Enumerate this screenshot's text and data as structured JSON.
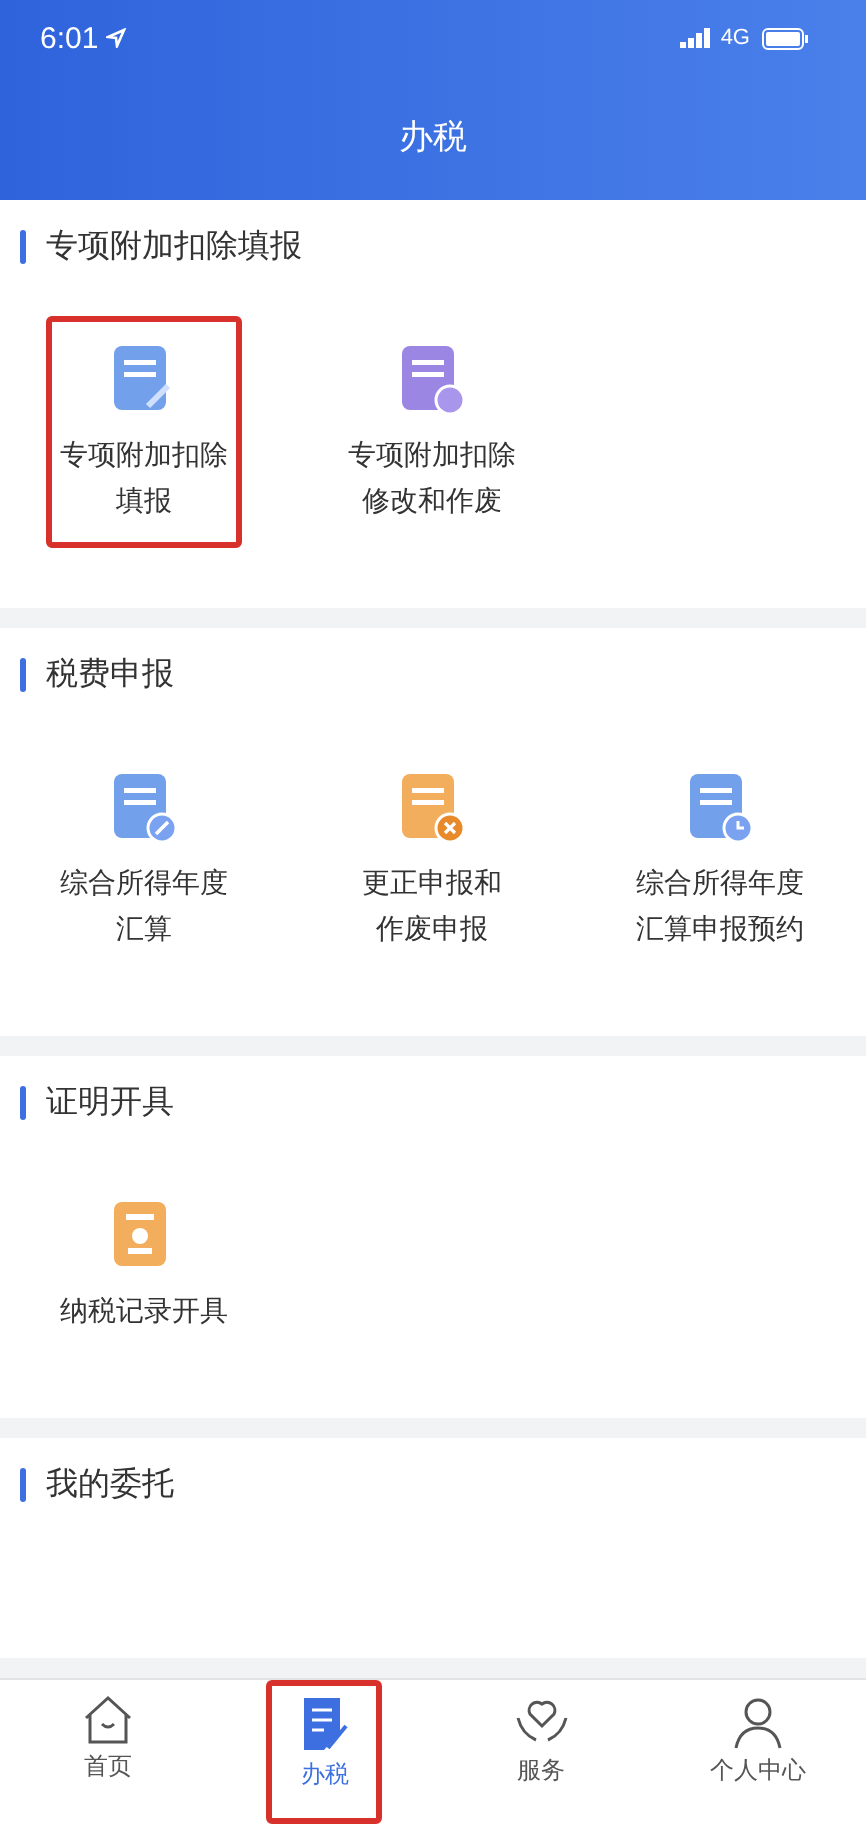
{
  "status_bar": {
    "time": "6:01",
    "network": "4G"
  },
  "header": {
    "title": "办税"
  },
  "sections": [
    {
      "title": "专项附加扣除填报",
      "items": [
        {
          "kind": "pen",
          "lines": [
            "专项附加扣除",
            "填报"
          ],
          "highlighted": true
        },
        {
          "kind": "gear",
          "lines": [
            "专项附加扣除",
            "修改和作废"
          ],
          "highlighted": false
        }
      ]
    },
    {
      "title": "税费申报",
      "items": [
        {
          "kind": "edit",
          "lines": [
            "综合所得年度",
            "汇算"
          ],
          "highlighted": false
        },
        {
          "kind": "cancel",
          "lines": [
            "更正申报和",
            "作废申报"
          ],
          "highlighted": false
        },
        {
          "kind": "clock",
          "lines": [
            "综合所得年度",
            "汇算申报预约"
          ],
          "highlighted": false
        }
      ]
    },
    {
      "title": "证明开具",
      "items": [
        {
          "kind": "certificate",
          "lines": [
            "纳税记录开具"
          ],
          "highlighted": false
        }
      ]
    },
    {
      "title": "我的委托"
    }
  ],
  "tab_bar": [
    {
      "kind": "home",
      "label": "首页",
      "selected": false,
      "highlighted": false
    },
    {
      "kind": "tax",
      "label": "办税",
      "selected": true,
      "highlighted": true
    },
    {
      "kind": "service",
      "label": "服务",
      "selected": false,
      "highlighted": false
    },
    {
      "kind": "person",
      "label": "个人中心",
      "selected": false,
      "highlighted": false
    }
  ]
}
